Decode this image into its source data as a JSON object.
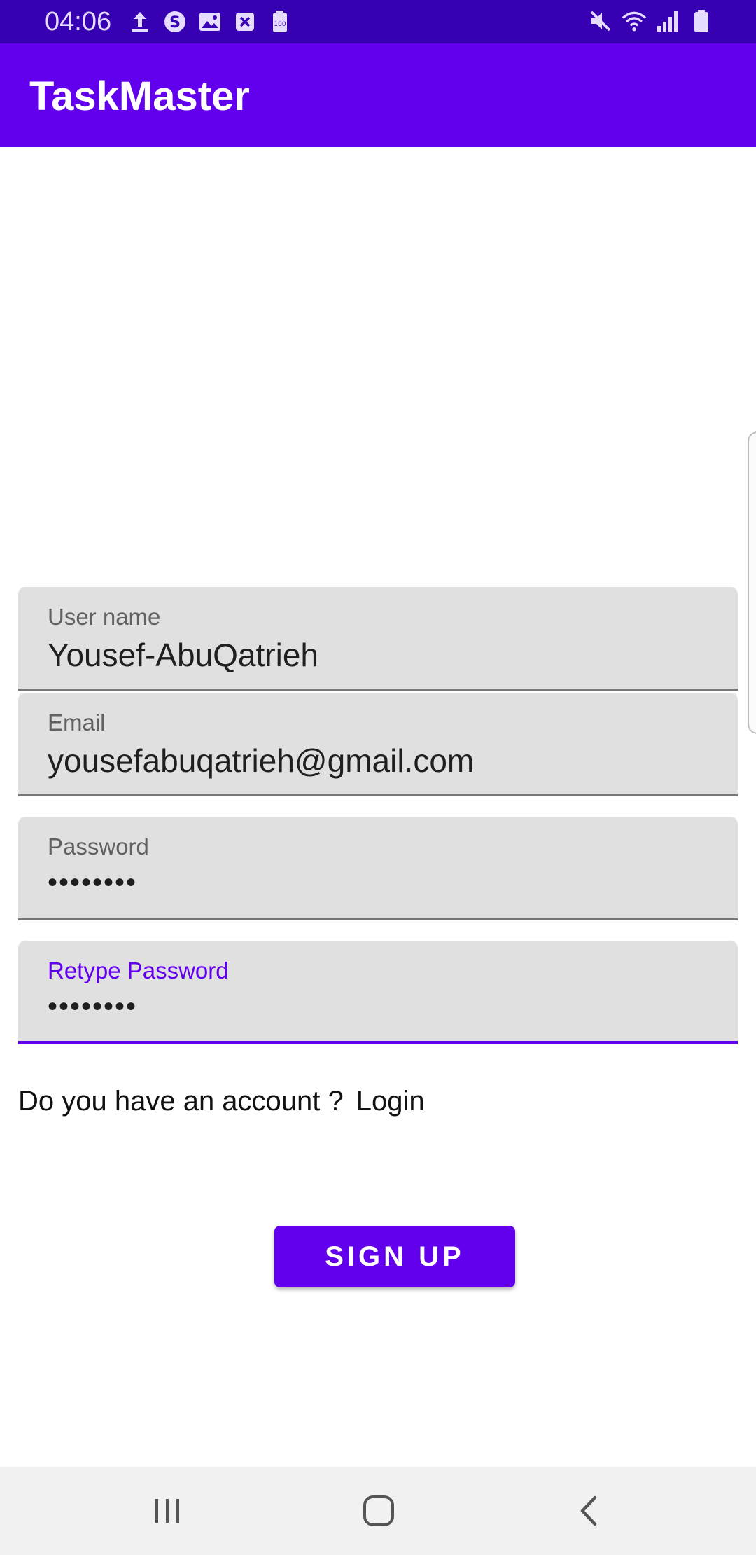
{
  "status_bar": {
    "time": "04:06",
    "left_icons": [
      "upload-icon",
      "s-app-icon",
      "image-icon",
      "x-box-icon",
      "battery-100-icon"
    ],
    "right_icons": [
      "mute-icon",
      "wifi-icon",
      "signal-icon",
      "battery-icon"
    ]
  },
  "app_bar": {
    "title": "TaskMaster"
  },
  "form": {
    "username": {
      "label": "User name",
      "value": "Yousef-AbuQatrieh"
    },
    "email": {
      "label": "Email",
      "value": "yousefabuqatrieh@gmail.com"
    },
    "password": {
      "label": "Password",
      "value": "••••••••"
    },
    "retype_password": {
      "label": "Retype Password",
      "value": "••••••••"
    }
  },
  "account_prompt": {
    "text": "Do you have an account ?",
    "link": "Login"
  },
  "signup_button": {
    "label": "SIGN UP"
  },
  "colors": {
    "primary": "#6200EE",
    "primary_dark": "#3700B3",
    "field_bg": "#e0e0e0"
  },
  "nav_bar": {
    "buttons": [
      "recents-icon",
      "home-icon",
      "back-icon"
    ]
  }
}
